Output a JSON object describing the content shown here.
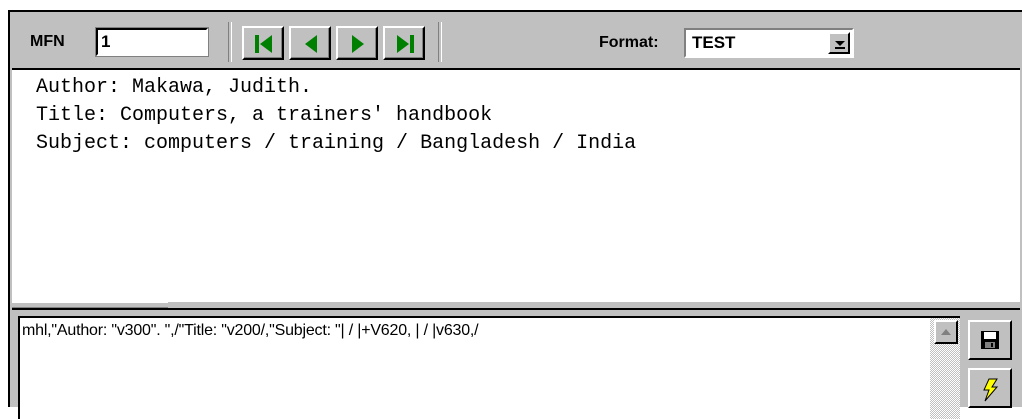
{
  "toolbar": {
    "mfn_label": "MFN",
    "mfn_value": "1",
    "nav_buttons": [
      "first-record",
      "previous-record",
      "next-record",
      "last-record"
    ],
    "format_label": "Format:",
    "format_value": "TEST"
  },
  "display": {
    "lines": [
      "Author: Makawa, Judith.",
      "Title: Computers, a trainers' handbook",
      "Subject: computers / training / Bangladesh / India"
    ]
  },
  "editor": {
    "text": "mhl,\"Author: \"v300\". \",/\"Title: \"v200/,\"Subject: \"| / |+V620, | / |v630,/"
  },
  "side_buttons": [
    "save-icon",
    "lightning-icon"
  ],
  "colors": {
    "button_green": "#008000",
    "button_face": "#c0c0c0",
    "lightning_yellow": "#ffff00"
  }
}
